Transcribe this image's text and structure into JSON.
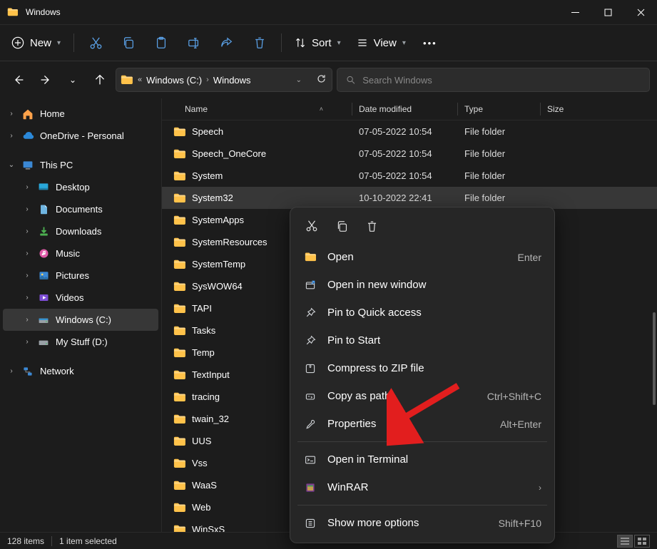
{
  "title": "Windows",
  "toolbar": {
    "new": "New",
    "sort": "Sort",
    "view": "View"
  },
  "breadcrumb": {
    "drive": "Windows (C:)",
    "folder": "Windows"
  },
  "search": {
    "placeholder": "Search Windows"
  },
  "columns": {
    "name": "Name",
    "date": "Date modified",
    "type": "Type",
    "size": "Size"
  },
  "sidebar": {
    "home": "Home",
    "onedrive": "OneDrive - Personal",
    "thispc": "This PC",
    "desktop": "Desktop",
    "documents": "Documents",
    "downloads": "Downloads",
    "music": "Music",
    "pictures": "Pictures",
    "videos": "Videos",
    "cdrive": "Windows (C:)",
    "ddrive": "My Stuff (D:)",
    "network": "Network"
  },
  "rows": [
    {
      "name": "Speech",
      "date": "07-05-2022 10:54",
      "type": "File folder"
    },
    {
      "name": "Speech_OneCore",
      "date": "07-05-2022 10:54",
      "type": "File folder"
    },
    {
      "name": "System",
      "date": "07-05-2022 10:54",
      "type": "File folder"
    },
    {
      "name": "System32",
      "date": "10-10-2022 22:41",
      "type": "File folder",
      "selected": true
    },
    {
      "name": "SystemApps",
      "date": "",
      "type": ""
    },
    {
      "name": "SystemResources",
      "date": "",
      "type": ""
    },
    {
      "name": "SystemTemp",
      "date": "",
      "type": ""
    },
    {
      "name": "SysWOW64",
      "date": "",
      "type": ""
    },
    {
      "name": "TAPI",
      "date": "",
      "type": ""
    },
    {
      "name": "Tasks",
      "date": "",
      "type": ""
    },
    {
      "name": "Temp",
      "date": "",
      "type": ""
    },
    {
      "name": "TextInput",
      "date": "",
      "type": ""
    },
    {
      "name": "tracing",
      "date": "",
      "type": ""
    },
    {
      "name": "twain_32",
      "date": "",
      "type": ""
    },
    {
      "name": "UUS",
      "date": "",
      "type": ""
    },
    {
      "name": "Vss",
      "date": "",
      "type": ""
    },
    {
      "name": "WaaS",
      "date": "",
      "type": ""
    },
    {
      "name": "Web",
      "date": "",
      "type": ""
    },
    {
      "name": "WinSxS",
      "date": "",
      "type": ""
    }
  ],
  "context": {
    "open": {
      "label": "Open",
      "shortcut": "Enter"
    },
    "open_new": {
      "label": "Open in new window"
    },
    "pin_quick": {
      "label": "Pin to Quick access"
    },
    "pin_start": {
      "label": "Pin to Start"
    },
    "zip": {
      "label": "Compress to ZIP file"
    },
    "copy_path": {
      "label": "Copy as path",
      "shortcut": "Ctrl+Shift+C"
    },
    "properties": {
      "label": "Properties",
      "shortcut": "Alt+Enter"
    },
    "terminal": {
      "label": "Open in Terminal"
    },
    "winrar": {
      "label": "WinRAR"
    },
    "more": {
      "label": "Show more options",
      "shortcut": "Shift+F10"
    }
  },
  "status": {
    "count": "128 items",
    "sel": "1 item selected"
  }
}
